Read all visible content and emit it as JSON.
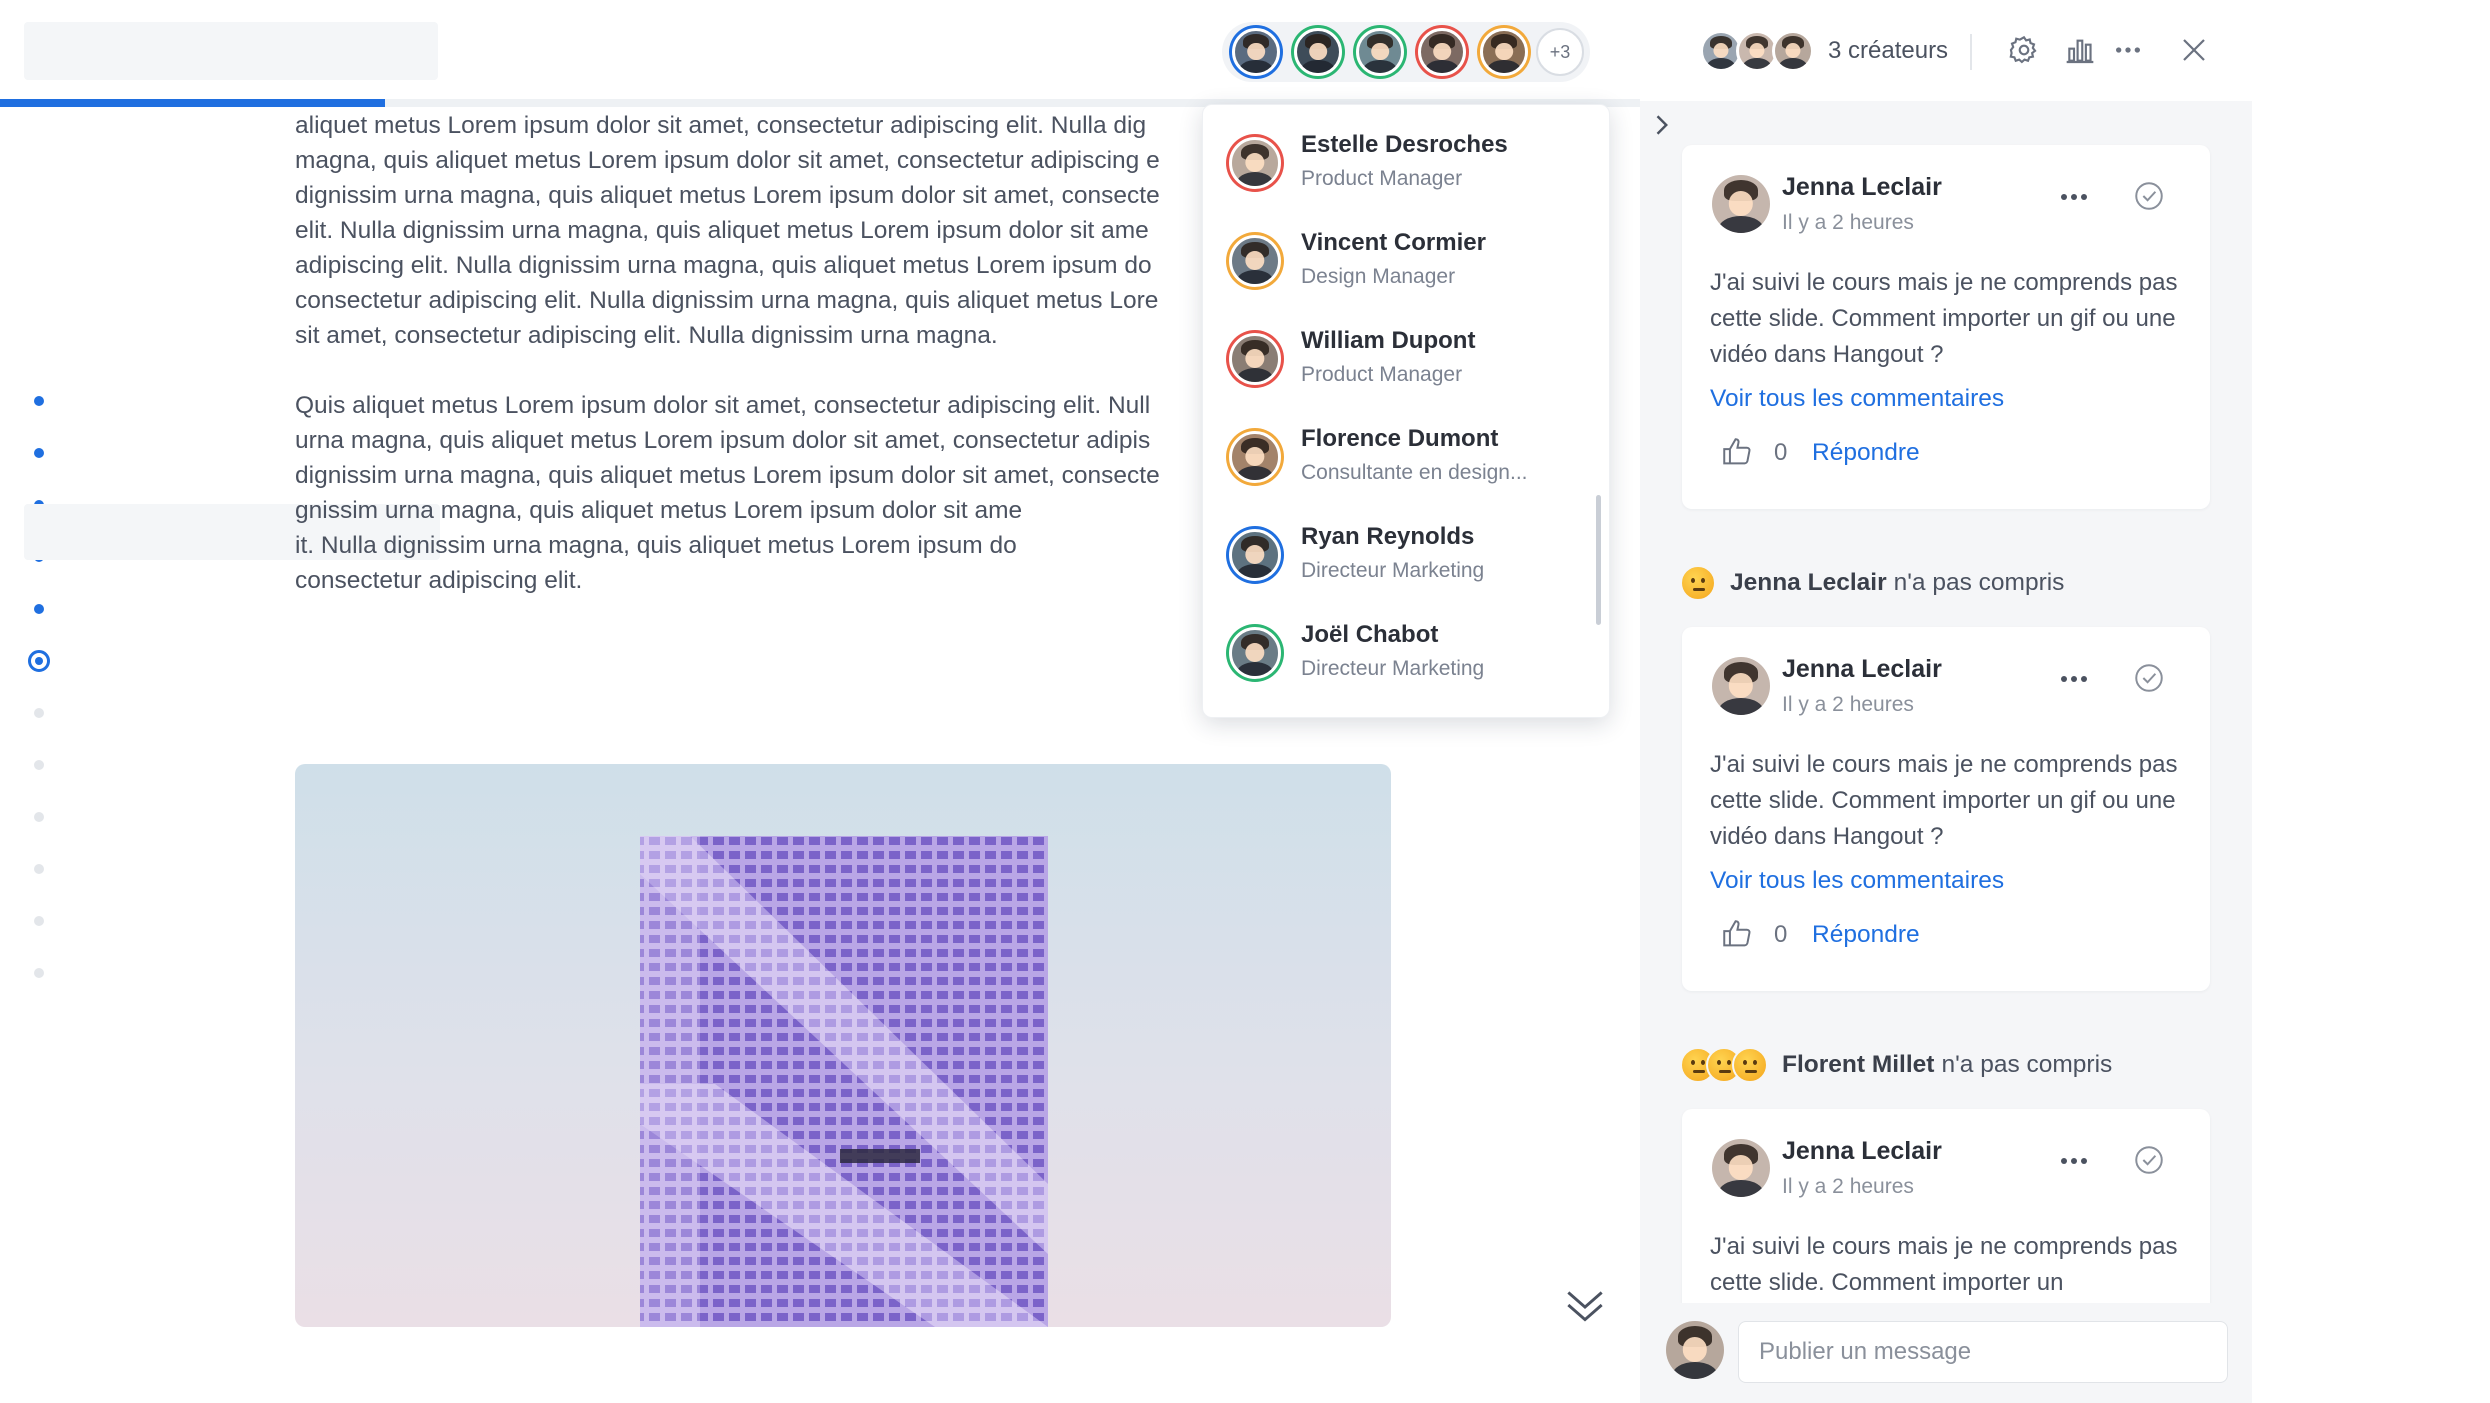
{
  "colors": {
    "accent": "#1f6fe0",
    "panel_bg": "#f5f6f8",
    "text": "#4b5260"
  },
  "progress": {
    "fraction": 0.235
  },
  "viewers": {
    "avatars": [
      {
        "name": "viewer-1",
        "ring": "#1f6fe0"
      },
      {
        "name": "viewer-2",
        "ring": "#2bb673"
      },
      {
        "name": "viewer-3",
        "ring": "#2bb673"
      },
      {
        "name": "viewer-4",
        "ring": "#e8524a"
      },
      {
        "name": "viewer-5",
        "ring": "#f2a93b"
      }
    ],
    "more_label": "+3"
  },
  "creators": {
    "label": "3 créateurs"
  },
  "icons": {
    "settings": "gear-icon",
    "stats": "bar-chart-icon",
    "more": "more-horizontal-icon",
    "close": "close-icon"
  },
  "dot_nav": {
    "states": [
      "done",
      "done",
      "done",
      "done",
      "done",
      "current",
      "todo",
      "todo",
      "todo",
      "todo",
      "todo",
      "todo"
    ]
  },
  "content": {
    "paragraphs": [
      [
        "aliquet metus Lorem ipsum dolor sit amet, consectetur adipiscing elit. Nulla dig",
        "magna, quis aliquet metus Lorem ipsum dolor sit amet, consectetur adipiscing e",
        "dignissim urna magna, quis aliquet metus Lorem ipsum dolor sit amet, consecte",
        "elit. Nulla dignissim urna magna, quis aliquet metus Lorem ipsum dolor sit ame",
        "adipiscing elit. Nulla dignissim urna magna, quis aliquet metus Lorem ipsum do",
        "consectetur adipiscing elit. Nulla dignissim urna magna, quis aliquet metus Lore",
        "sit amet, consectetur adipiscing elit. Nulla dignissim urna magna."
      ],
      [
        "Quis aliquet metus Lorem ipsum dolor sit amet, consectetur adipiscing elit. Null",
        "urna magna, quis aliquet metus Lorem ipsum dolor sit amet, consectetur adipis",
        "dignissim urna magna, quis aliquet metus Lorem ipsum dolor sit amet, consecte",
        "gnissim urna magna, quis aliquet metus Lorem ipsum dolor sit ame",
        "it. Nulla dignissim urna magna, quis aliquet metus Lorem ipsum do",
        "consectetur adipiscing elit."
      ]
    ]
  },
  "participants": [
    {
      "name": "Estelle Desroches",
      "role": "Product Manager",
      "ring": "#e8524a"
    },
    {
      "name": "Vincent Cormier",
      "role": "Design Manager",
      "ring": "#f2a93b"
    },
    {
      "name": "William Dupont",
      "role": "Product Manager",
      "ring": "#e8524a"
    },
    {
      "name": "Florence Dumont",
      "role": "Consultante en design...",
      "ring": "#f2a93b"
    },
    {
      "name": "Ryan Reynolds",
      "role": "Directeur Marketing",
      "ring": "#1f6fe0"
    },
    {
      "name": "Joël Chabot",
      "role": "Directeur Marketing",
      "ring": "#2bb673"
    }
  ],
  "comments": [
    {
      "author": "Jenna Leclair",
      "time": "Il y a 2 heures",
      "text": "J'ai suivi le cours mais je ne comprends pas cette slide. Comment importer un gif ou une vidéo dans Hangout ?",
      "link": "Voir tous les commentaires",
      "likes": "0",
      "reply": "Répondre"
    },
    {
      "author": "Jenna Leclair",
      "time": "Il y a 2 heures",
      "text": "J'ai suivi le cours mais je ne comprends pas cette slide. Comment importer un gif ou une vidéo dans Hangout ?",
      "link": "Voir tous les commentaires",
      "likes": "0",
      "reply": "Répondre"
    },
    {
      "author": "Jenna Leclair",
      "time": "Il y a 2 heures",
      "text": "J'ai suivi le cours mais je ne comprends pas cette slide. Comment importer un",
      "link": "",
      "likes": "",
      "reply": ""
    }
  ],
  "reactions": [
    {
      "name": "Jenna Leclair",
      "text": "n'a pas compris",
      "emojis": 1
    },
    {
      "name": "Florent Millet",
      "text": "n'a pas compris",
      "emojis": 3
    }
  ],
  "composer": {
    "placeholder": "Publier un message"
  }
}
